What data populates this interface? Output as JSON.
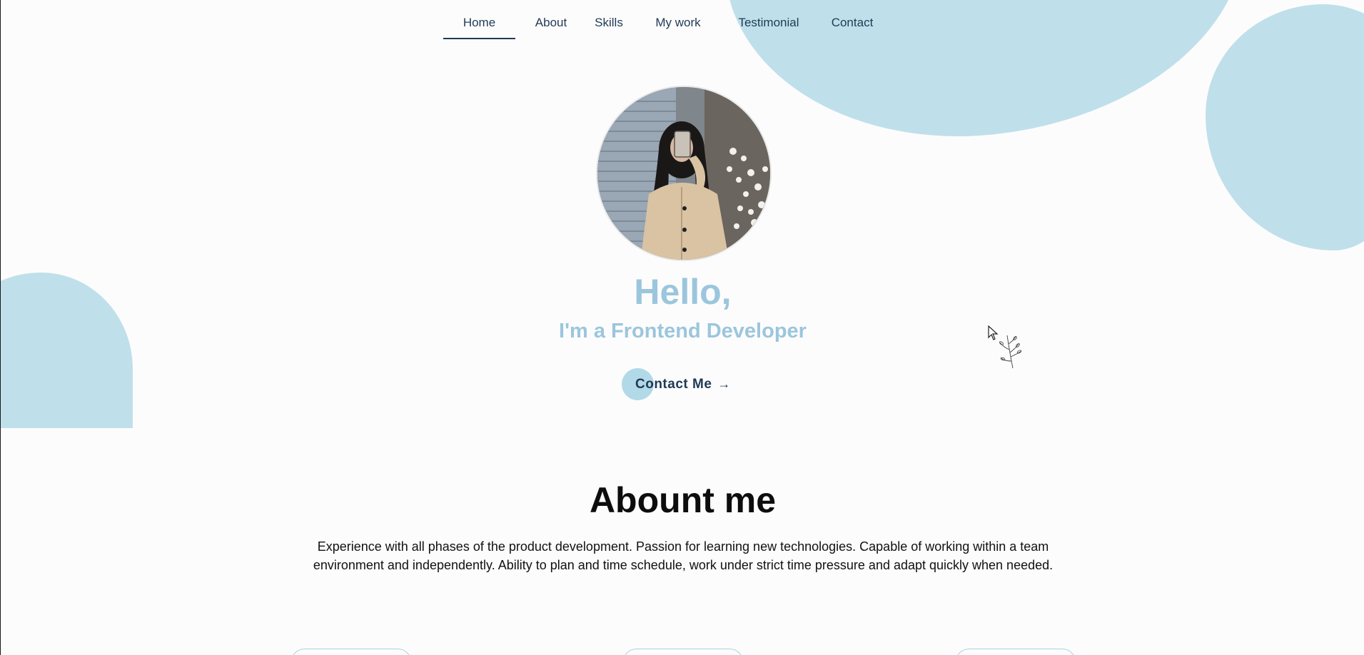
{
  "nav": {
    "items": [
      {
        "label": "Home",
        "active": true
      },
      {
        "label": "About",
        "active": false
      },
      {
        "label": "Skills",
        "active": false
      },
      {
        "label": "My work",
        "active": false
      },
      {
        "label": "Testimonial",
        "active": false
      },
      {
        "label": "Contact",
        "active": false
      }
    ]
  },
  "hero": {
    "greeting": "Hello,",
    "role": "I'm a Frontend Developer",
    "cta_label": "Contact Me",
    "cta_icon": "arrow-right-icon",
    "avatar_icon": "profile-photo"
  },
  "about": {
    "title": "Abount me",
    "description": "Experience with all phases of the product development. Passion for learning new technologies. Capable of working within a team environment and independently. Ability to plan and time schedule, work under strict time pressure and adapt quickly when needed."
  },
  "colors": {
    "accent": "#9bc6dd",
    "blob": "#bfe0ea",
    "nav_text": "#1f3a55",
    "background": "#fdfcfc"
  }
}
